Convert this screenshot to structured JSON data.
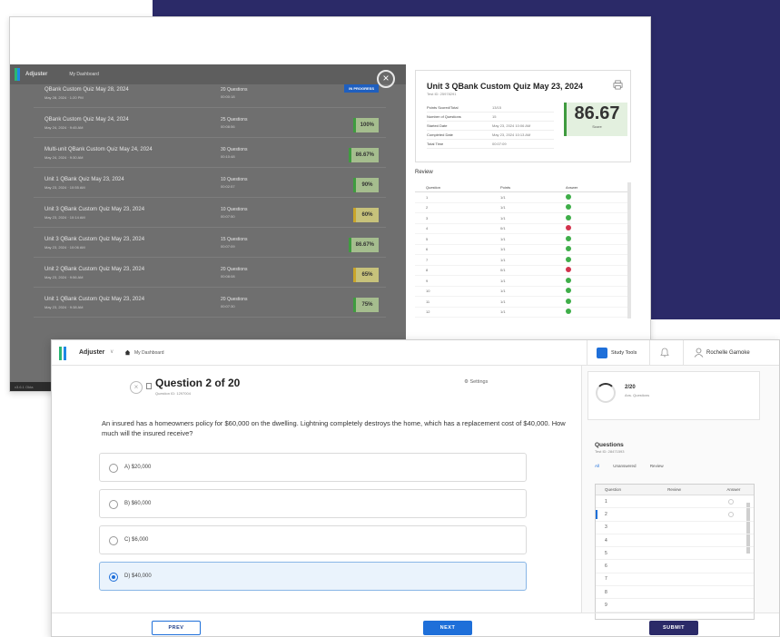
{
  "back": {
    "brand": "Adjuster",
    "nav_dashboard": "My Dashboard",
    "close_glyph": "×",
    "footer": "v3.6.1 Okta",
    "quizzes": [
      {
        "title": "QBank Custom Quiz May 28, 2024",
        "date": "May 28, 2024 · 1:20 PM",
        "questions": "20 Questions",
        "time": "00:00:18",
        "badge": "IN PROGRESS",
        "kind": "prog"
      },
      {
        "title": "QBank Custom Quiz May 24, 2024",
        "date": "May 24, 2024 · 9:45 AM",
        "questions": "25 Questions",
        "time": "00:08:56",
        "badge": "100",
        "kind": "green"
      },
      {
        "title": "Multi-unit QBank Custom Quiz May 24, 2024",
        "date": "May 24, 2024 · 9:30 AM",
        "questions": "30 Questions",
        "time": "00:10:48",
        "badge": "86.67",
        "kind": "green"
      },
      {
        "title": "Unit 1 QBank Quiz May 23, 2024",
        "date": "May 23, 2024 · 10:55 AM",
        "questions": "10 Questions",
        "time": "00:02:57",
        "badge": "90",
        "kind": "green"
      },
      {
        "title": "Unit 3 QBank Custom Quiz May 23, 2024",
        "date": "May 23, 2024 · 10:14 AM",
        "questions": "10 Questions",
        "time": "00:07:50",
        "badge": "60",
        "kind": "yellow"
      },
      {
        "title": "Unit 3 QBank Custom Quiz May 23, 2024",
        "date": "May 23, 2024 · 10:06 AM",
        "questions": "15 Questions",
        "time": "00:07:09",
        "badge": "86.67",
        "kind": "green"
      },
      {
        "title": "Unit 2 QBank Custom Quiz May 23, 2024",
        "date": "May 23, 2024 · 9:56 AM",
        "questions": "20 Questions",
        "time": "00:08:08",
        "badge": "65",
        "kind": "yellow"
      },
      {
        "title": "Unit 1 QBank Custom Quiz May 23, 2024",
        "date": "May 23, 2024 · 9:38 AM",
        "questions": "20 Questions",
        "time": "00:07:30",
        "badge": "75",
        "kind": "green"
      }
    ],
    "detail": {
      "title": "Unit 3 QBank Custom Quiz May 23, 2024",
      "test_id": "Test ID: 25978291",
      "info": [
        {
          "k": "Points Scored/Total",
          "v": "13/15"
        },
        {
          "k": "Number of Questions",
          "v": "15"
        },
        {
          "k": "Started Date",
          "v": "May 23, 2024 10:06 AM"
        },
        {
          "k": "Completed Date",
          "v": "May 23, 2024 10:13 AM"
        },
        {
          "k": "Total Time",
          "v": "00:07:09"
        }
      ],
      "score": "86.67",
      "score_label": "Score",
      "review_label": "Review",
      "review_headers": [
        "Question",
        "Points",
        "Answer"
      ],
      "review_rows": [
        {
          "q": "1",
          "p": "1/1",
          "ok": true
        },
        {
          "q": "2",
          "p": "1/1",
          "ok": true
        },
        {
          "q": "3",
          "p": "1/1",
          "ok": true
        },
        {
          "q": "4",
          "p": "0/1",
          "ok": false
        },
        {
          "q": "5",
          "p": "1/1",
          "ok": true
        },
        {
          "q": "6",
          "p": "1/1",
          "ok": true
        },
        {
          "q": "7",
          "p": "1/1",
          "ok": true
        },
        {
          "q": "8",
          "p": "0/1",
          "ok": false
        },
        {
          "q": "9",
          "p": "1/1",
          "ok": true
        },
        {
          "q": "10",
          "p": "1/1",
          "ok": true
        },
        {
          "q": "11",
          "p": "1/1",
          "ok": true
        },
        {
          "q": "12",
          "p": "1/1",
          "ok": true
        }
      ]
    }
  },
  "front": {
    "brand": "Adjuster",
    "caret": "∨",
    "nav_dashboard": "My Dashboard",
    "study_tools": "Study Tools",
    "user_name": "Rochelle Gamoke",
    "question_title": "Question 2 of 20",
    "question_id": "Question ID: 1297004",
    "settings": "⚙ Settings",
    "question_text": "An insured has a homeowners policy for $60,000 on the dwelling. Lightning completely destroys the home, which has a replacement cost of $40,000. How much will the insured receive?",
    "options": [
      {
        "label": "A) $20,000",
        "selected": false
      },
      {
        "label": "B) $60,000",
        "selected": false
      },
      {
        "label": "C) $6,000",
        "selected": false
      },
      {
        "label": "D) $40,000",
        "selected": true
      }
    ],
    "prev_label": "PREV",
    "next_label": "NEXT",
    "submit_label": "SUBMIT",
    "progress_value": "2/20",
    "progress_label": "Ans. Questions",
    "questions_heading": "Questions",
    "questions_test_id": "Test ID: 28471593",
    "tabs": [
      "All",
      "Unanswered",
      "Review"
    ],
    "qtable_headers": [
      "Question",
      "Review",
      "Answer"
    ],
    "qtable_rows": [
      "1",
      "2",
      "3",
      "4",
      "5",
      "6",
      "7",
      "8",
      "9"
    ]
  },
  "colors": {
    "navy": "#2b2a68",
    "blue": "#1e6fd9",
    "green": "#3fae49",
    "red": "#d2334d"
  }
}
